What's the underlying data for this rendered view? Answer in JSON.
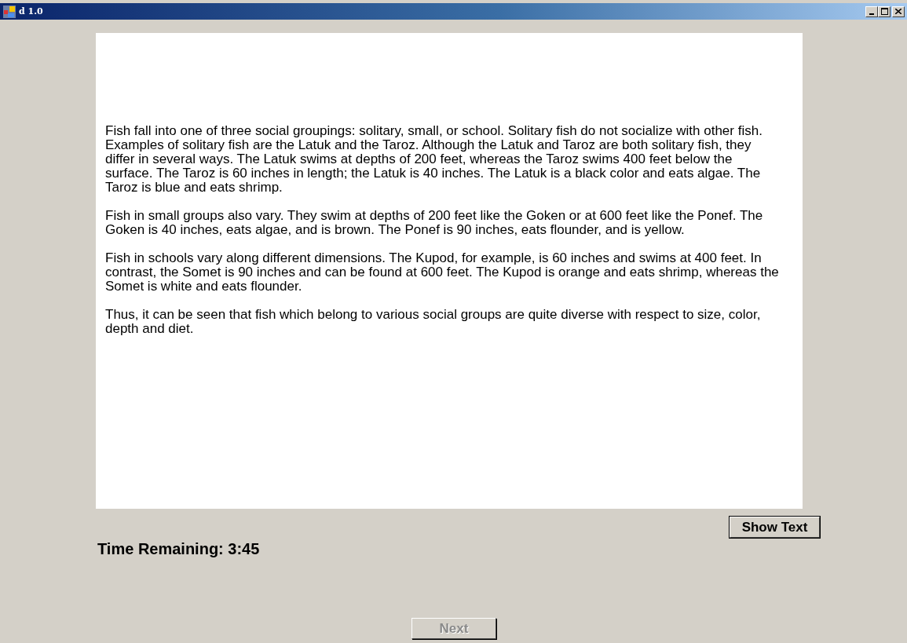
{
  "window": {
    "title": "d 1.0"
  },
  "passage": {
    "paragraphs": [
      "Fish fall into one of three social groupings: solitary, small, or school. Solitary fish do not socialize with other fish. Examples of solitary fish are the Latuk and the Taroz. Although the Latuk and Taroz are both solitary fish, they differ in several ways. The Latuk swims at depths of 200 feet, whereas the Taroz swims 400 feet below the surface. The Taroz is 60 inches in length; the Latuk is 40 inches. The Latuk is a black color and eats algae. The Taroz is blue and eats shrimp.",
      "Fish in small groups also vary. They swim at depths of 200 feet like the Goken or at 600 feet like the Ponef. The Goken is 40 inches, eats algae, and is brown. The Ponef is 90 inches, eats flounder, and is yellow.",
      "Fish in schools vary along different dimensions. The Kupod, for example, is 60 inches and swims at 400 feet. In contrast, the Somet is 90 inches and can be found at 600 feet. The Kupod is orange and eats shrimp, whereas the Somet is white and eats flounder.",
      "Thus, it can be seen that fish which belong to various social groups are quite diverse with respect to size, color, depth and diet."
    ]
  },
  "show_text_button": {
    "label": "Show Text",
    "disabled": false
  },
  "timer": {
    "text": "Time Remaining: 3:45"
  },
  "next_button": {
    "label": "Next",
    "disabled": true
  }
}
